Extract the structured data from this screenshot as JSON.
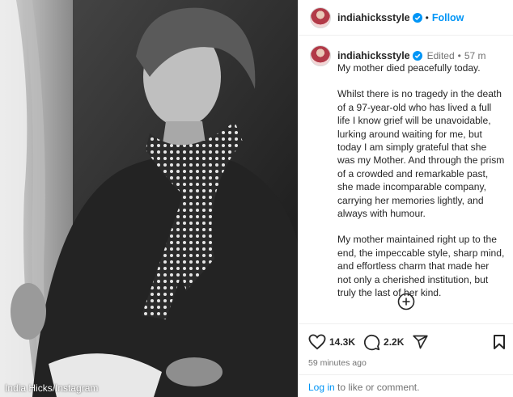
{
  "photo": {
    "credit": "India Hicks/Instagram"
  },
  "header": {
    "username": "indiahicksstyle",
    "dot": "•",
    "follow_label": "Follow",
    "verified_icon": "verified-badge-icon"
  },
  "caption": {
    "username": "indiahicksstyle",
    "edited": "Edited",
    "dot": "•",
    "age": "57 m",
    "paragraphs": [
      "My mother died peacefully today.",
      "Whilst there is no tragedy in the death of a 97-year-old who has lived a full life I know grief will be unavoidable, lurking around waiting for me, but today I am simply grateful that she was my Mother. And through the prism of a crowded and remarkable past, she made incomparable company, carrying her memories lightly, and always with humour.",
      "My mother maintained right up to the end, the impeccable style, sharp mind, and effortless charm that made her not only a cherished institution, but truly the last of her kind."
    ]
  },
  "actions": {
    "likes": "14.3K",
    "comments": "2.2K",
    "time": "59 minutes ago"
  },
  "login": {
    "link": "Log in",
    "text": " to like or comment."
  },
  "colors": {
    "accent": "#0095f6",
    "muted": "#737373",
    "text": "#262626"
  }
}
